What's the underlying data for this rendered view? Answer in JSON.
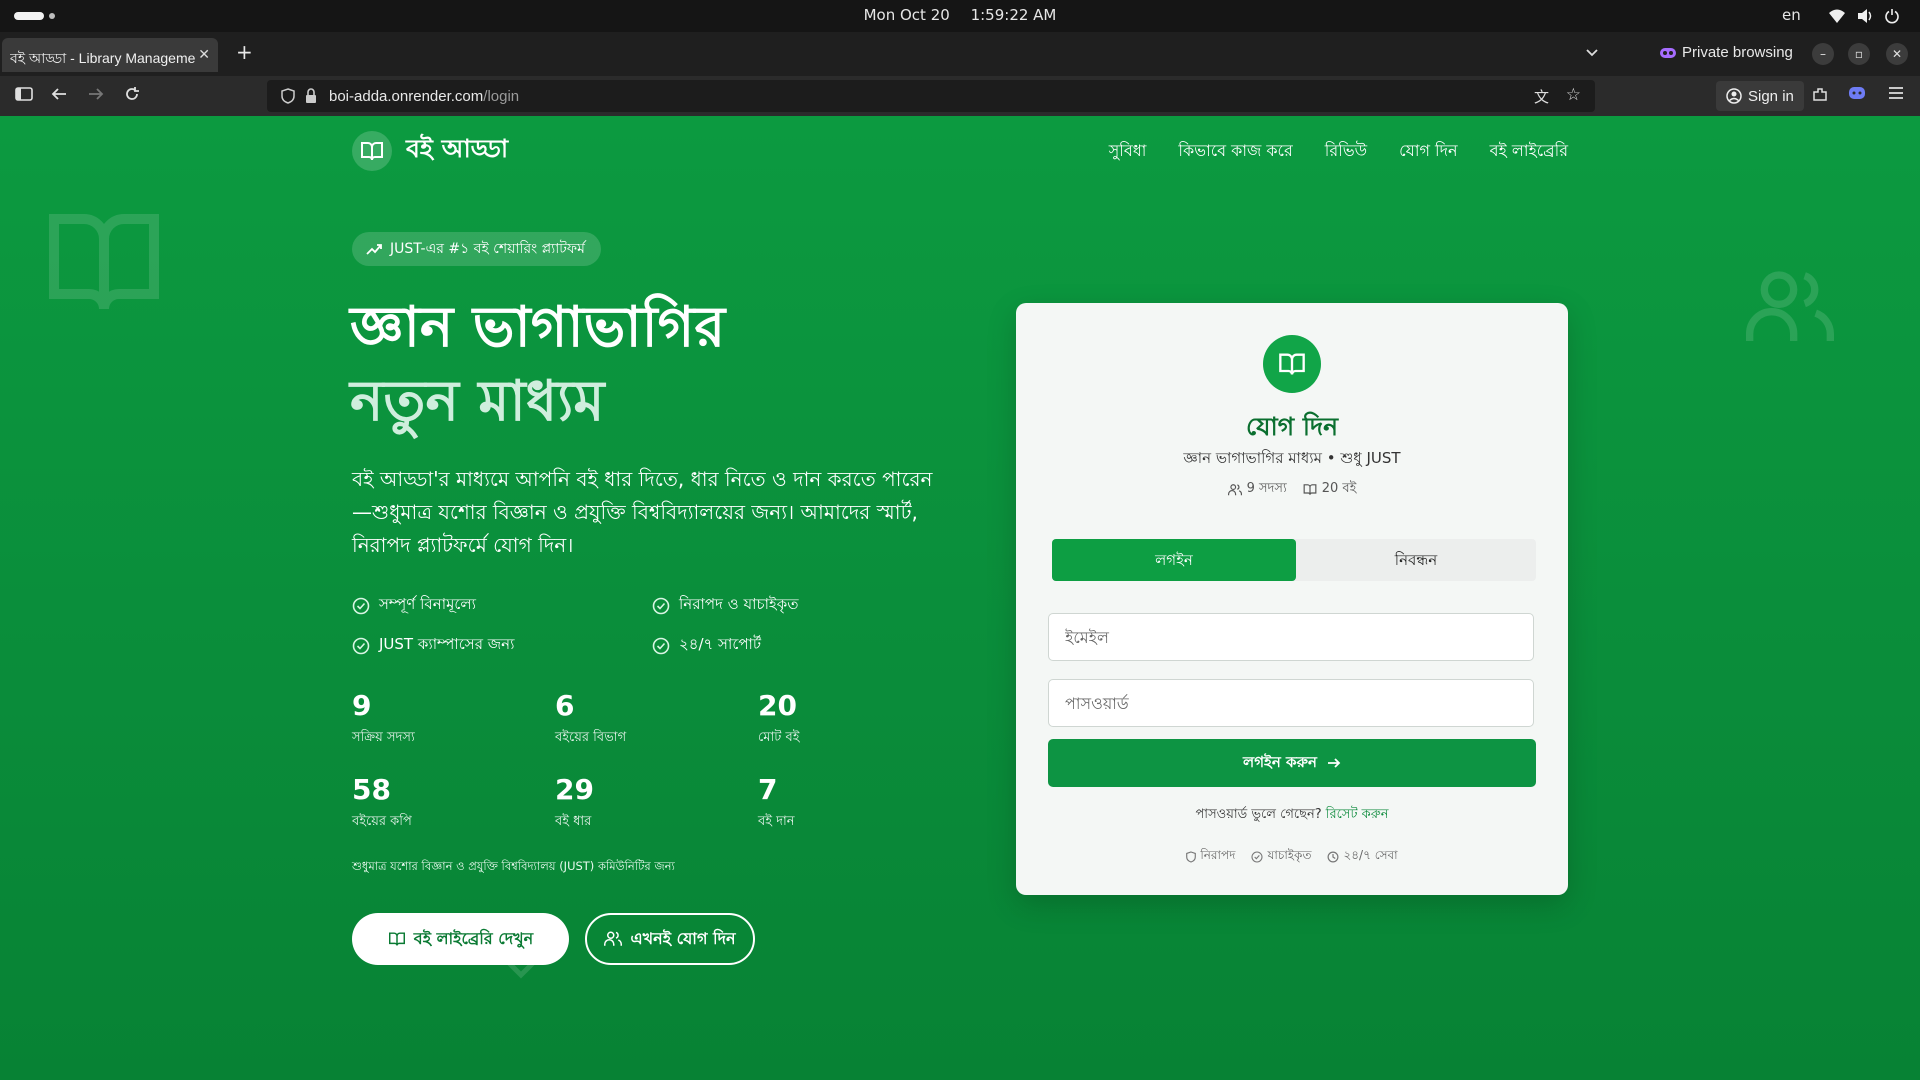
{
  "os": {
    "date": "Mon Oct 20",
    "time": "1:59:22 AM",
    "lang": "en"
  },
  "browser": {
    "tab_title": "বই আড্ডা - Library Manageme",
    "private_label": "Private browsing",
    "url_host": "boi-adda.onrender.com",
    "url_path": "/login",
    "sign_in": "Sign in"
  },
  "site": {
    "logo_text": "বই আড্ডা",
    "nav": [
      "সুবিধা",
      "কিভাবে কাজ করে",
      "রিভিউ",
      "যোগ দিন",
      "বই লাইব্রেরি"
    ]
  },
  "hero": {
    "badge": "JUST-এর #১ বই শেয়ারিং প্ল্যাটফর্ম",
    "title_line1": "জ্ঞান ভাগাভাগির",
    "title_line2": "নতুন মাধ্যম",
    "description": "বই আড্ডা'র মাধ্যমে আপনি বই ধার দিতে, ধার নিতে ও দান করতে পারেন—শুধুমাত্র যশোর বিজ্ঞান ও প্রযুক্তি বিশ্ববিদ্যালয়ের জন্য। আমাদের স্মার্ট, নিরাপদ প্ল্যাটফর্মে যোগ দিন।",
    "features": [
      "সম্পূর্ণ বিনামূল্যে",
      "নিরাপদ ও যাচাইকৃত",
      "JUST ক্যাম্পাসের জন্য",
      "২৪/৭ সাপোর্ট"
    ],
    "stats": [
      {
        "value": "9",
        "label": "সক্রিয় সদস্য"
      },
      {
        "value": "6",
        "label": "বইয়ের বিভাগ"
      },
      {
        "value": "20",
        "label": "মোট বই"
      },
      {
        "value": "58",
        "label": "বইয়ের কপি"
      },
      {
        "value": "29",
        "label": "বই ধার"
      },
      {
        "value": "7",
        "label": "বই দান"
      }
    ],
    "footnote": "শুধুমাত্র যশোর বিজ্ঞান ও প্রযুক্তি বিশ্ববিদ্যালয় (JUST) কমিউনিটির জন্য",
    "btn_library": "বই লাইব্রেরি দেখুন",
    "btn_join": "এখনই যোগ দিন"
  },
  "card": {
    "title": "যোগ দিন",
    "subtitle": "জ্ঞান ভাগাভাগির মাধ্যম • শুধু JUST",
    "members": "9 সদস্য",
    "books": "20 বই",
    "tab_login": "লগইন",
    "tab_register": "নিবন্ধন",
    "email_placeholder": "ইমেইল",
    "password_placeholder": "পাসওয়ার্ড",
    "login_button": "লগইন করুন",
    "forgot_text": "পাসওয়ার্ড ভুলে গেছেন?",
    "reset_link": "রিসেট করুন",
    "trust": [
      "নিরাপদ",
      "যাচাইকৃত",
      "২৪/৭ সেবা"
    ]
  },
  "colors": {
    "brand_green": "#0a8f3c",
    "button_green": "#0d9443",
    "title_green": "#0a6f2f"
  },
  "icons": [
    "book-open-icon",
    "trending-up-icon",
    "check-circle-icon",
    "users-icon",
    "arrow-right-icon",
    "shield-icon",
    "clock-icon"
  ]
}
